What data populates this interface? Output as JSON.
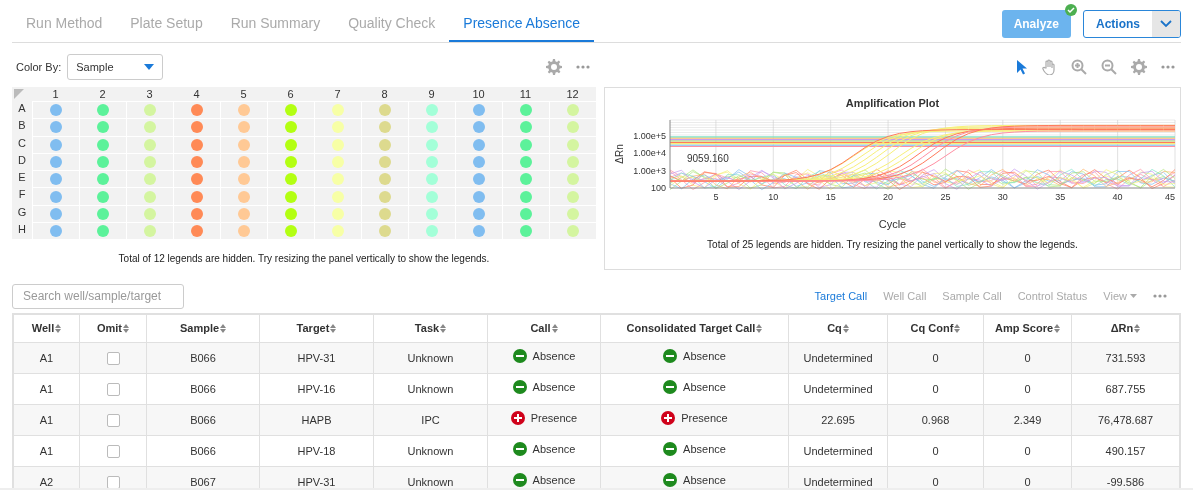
{
  "tabs": [
    {
      "label": "Run Method",
      "selected": false
    },
    {
      "label": "Plate Setup",
      "selected": false
    },
    {
      "label": "Run Summary",
      "selected": false
    },
    {
      "label": "Quality Check",
      "selected": false
    },
    {
      "label": "Presence Absence",
      "selected": true
    }
  ],
  "header_buttons": {
    "analyze": "Analyze",
    "analyze_done": true,
    "actions": "Actions"
  },
  "plate": {
    "color_by_label": "Color By:",
    "color_by_value": "Sample",
    "rows": [
      "A",
      "B",
      "C",
      "D",
      "E",
      "F",
      "G",
      "H"
    ],
    "columns": [
      {
        "label": "1",
        "color": "#80bdf0"
      },
      {
        "label": "2",
        "color": "#5cf29a"
      },
      {
        "label": "3",
        "color": "#d4f5a0"
      },
      {
        "label": "4",
        "color": "#ff8a56"
      },
      {
        "label": "5",
        "color": "#ffc995"
      },
      {
        "label": "6",
        "color": "#b3ff12"
      },
      {
        "label": "7",
        "color": "#f7ffa6"
      },
      {
        "label": "8",
        "color": "#ddda8e"
      },
      {
        "label": "9",
        "color": "#a3ffd8"
      },
      {
        "label": "10",
        "color": "#80bdf0"
      },
      {
        "label": "11",
        "color": "#5cf29a"
      },
      {
        "label": "12",
        "color": "#d4f5a0"
      }
    ],
    "legend_note": "Total of 12 legends are hidden. Try resizing the panel vertically to show the legends."
  },
  "plot": {
    "title": "Amplification Plot",
    "ylabel": "ΔRn",
    "xlabel": "Cycle",
    "yticks": [
      "1.00e+5",
      "1.00e+4",
      "1.00e+3",
      "100"
    ],
    "xticks": [
      "5",
      "10",
      "15",
      "20",
      "25",
      "30",
      "35",
      "40",
      "45"
    ],
    "threshold_label": "9059.160",
    "legend_note": "Total of 25 legends are hidden. Try resizing the panel vertically to show the legends."
  },
  "search": {
    "placeholder": "Search well/sample/target"
  },
  "views": [
    {
      "label": "Target Call",
      "selected": true
    },
    {
      "label": "Well Call",
      "selected": false
    },
    {
      "label": "Sample Call",
      "selected": false
    },
    {
      "label": "Control Status",
      "selected": false
    }
  ],
  "view_menu": "View",
  "table": {
    "columns": [
      "Well",
      "Omit",
      "Sample",
      "Target",
      "Task",
      "Call",
      "Consolidated Target Call",
      "Cq",
      "Cq Conf",
      "Amp Score",
      "ΔRn"
    ],
    "rows": [
      {
        "well": "A1",
        "omit": false,
        "sample": "B066",
        "target": "HPV-31",
        "task": "Unknown",
        "call": {
          "kind": "absence",
          "label": "Absence"
        },
        "consolidated": {
          "kind": "absence",
          "label": "Absence"
        },
        "cq": "Undetermined",
        "cq_conf": "0",
        "amp_score": "0",
        "delta_rn": "731.593"
      },
      {
        "well": "A1",
        "omit": false,
        "sample": "B066",
        "target": "HPV-16",
        "task": "Unknown",
        "call": {
          "kind": "absence",
          "label": "Absence"
        },
        "consolidated": {
          "kind": "absence",
          "label": "Absence"
        },
        "cq": "Undetermined",
        "cq_conf": "0",
        "amp_score": "0",
        "delta_rn": "687.755"
      },
      {
        "well": "A1",
        "omit": false,
        "sample": "B066",
        "target": "HAPB",
        "task": "IPC",
        "call": {
          "kind": "presence",
          "label": "Presence"
        },
        "consolidated": {
          "kind": "presence",
          "label": "Presence"
        },
        "cq": "22.695",
        "cq_conf": "0.968",
        "amp_score": "2.349",
        "delta_rn": "76,478.687"
      },
      {
        "well": "A1",
        "omit": false,
        "sample": "B066",
        "target": "HPV-18",
        "task": "Unknown",
        "call": {
          "kind": "absence",
          "label": "Absence"
        },
        "consolidated": {
          "kind": "absence",
          "label": "Absence"
        },
        "cq": "Undetermined",
        "cq_conf": "0",
        "amp_score": "0",
        "delta_rn": "490.157"
      },
      {
        "well": "A2",
        "omit": false,
        "sample": "B067",
        "target": "HPV-31",
        "task": "Unknown",
        "call": {
          "kind": "absence",
          "label": "Absence"
        },
        "consolidated": {
          "kind": "absence",
          "label": "Absence"
        },
        "cq": "Undetermined",
        "cq_conf": "0",
        "amp_score": "0",
        "delta_rn": "-99.586"
      }
    ]
  }
}
